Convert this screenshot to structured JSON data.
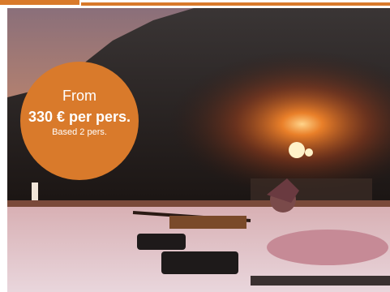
{
  "offer": {
    "from_label": "From",
    "price": "330 € per pers.",
    "note": "Based 2 pers."
  },
  "colors": {
    "accent": "#d97a2b",
    "badge_text": "#ffffff"
  },
  "image": {
    "subject": "biathlon-shooting-photo"
  }
}
